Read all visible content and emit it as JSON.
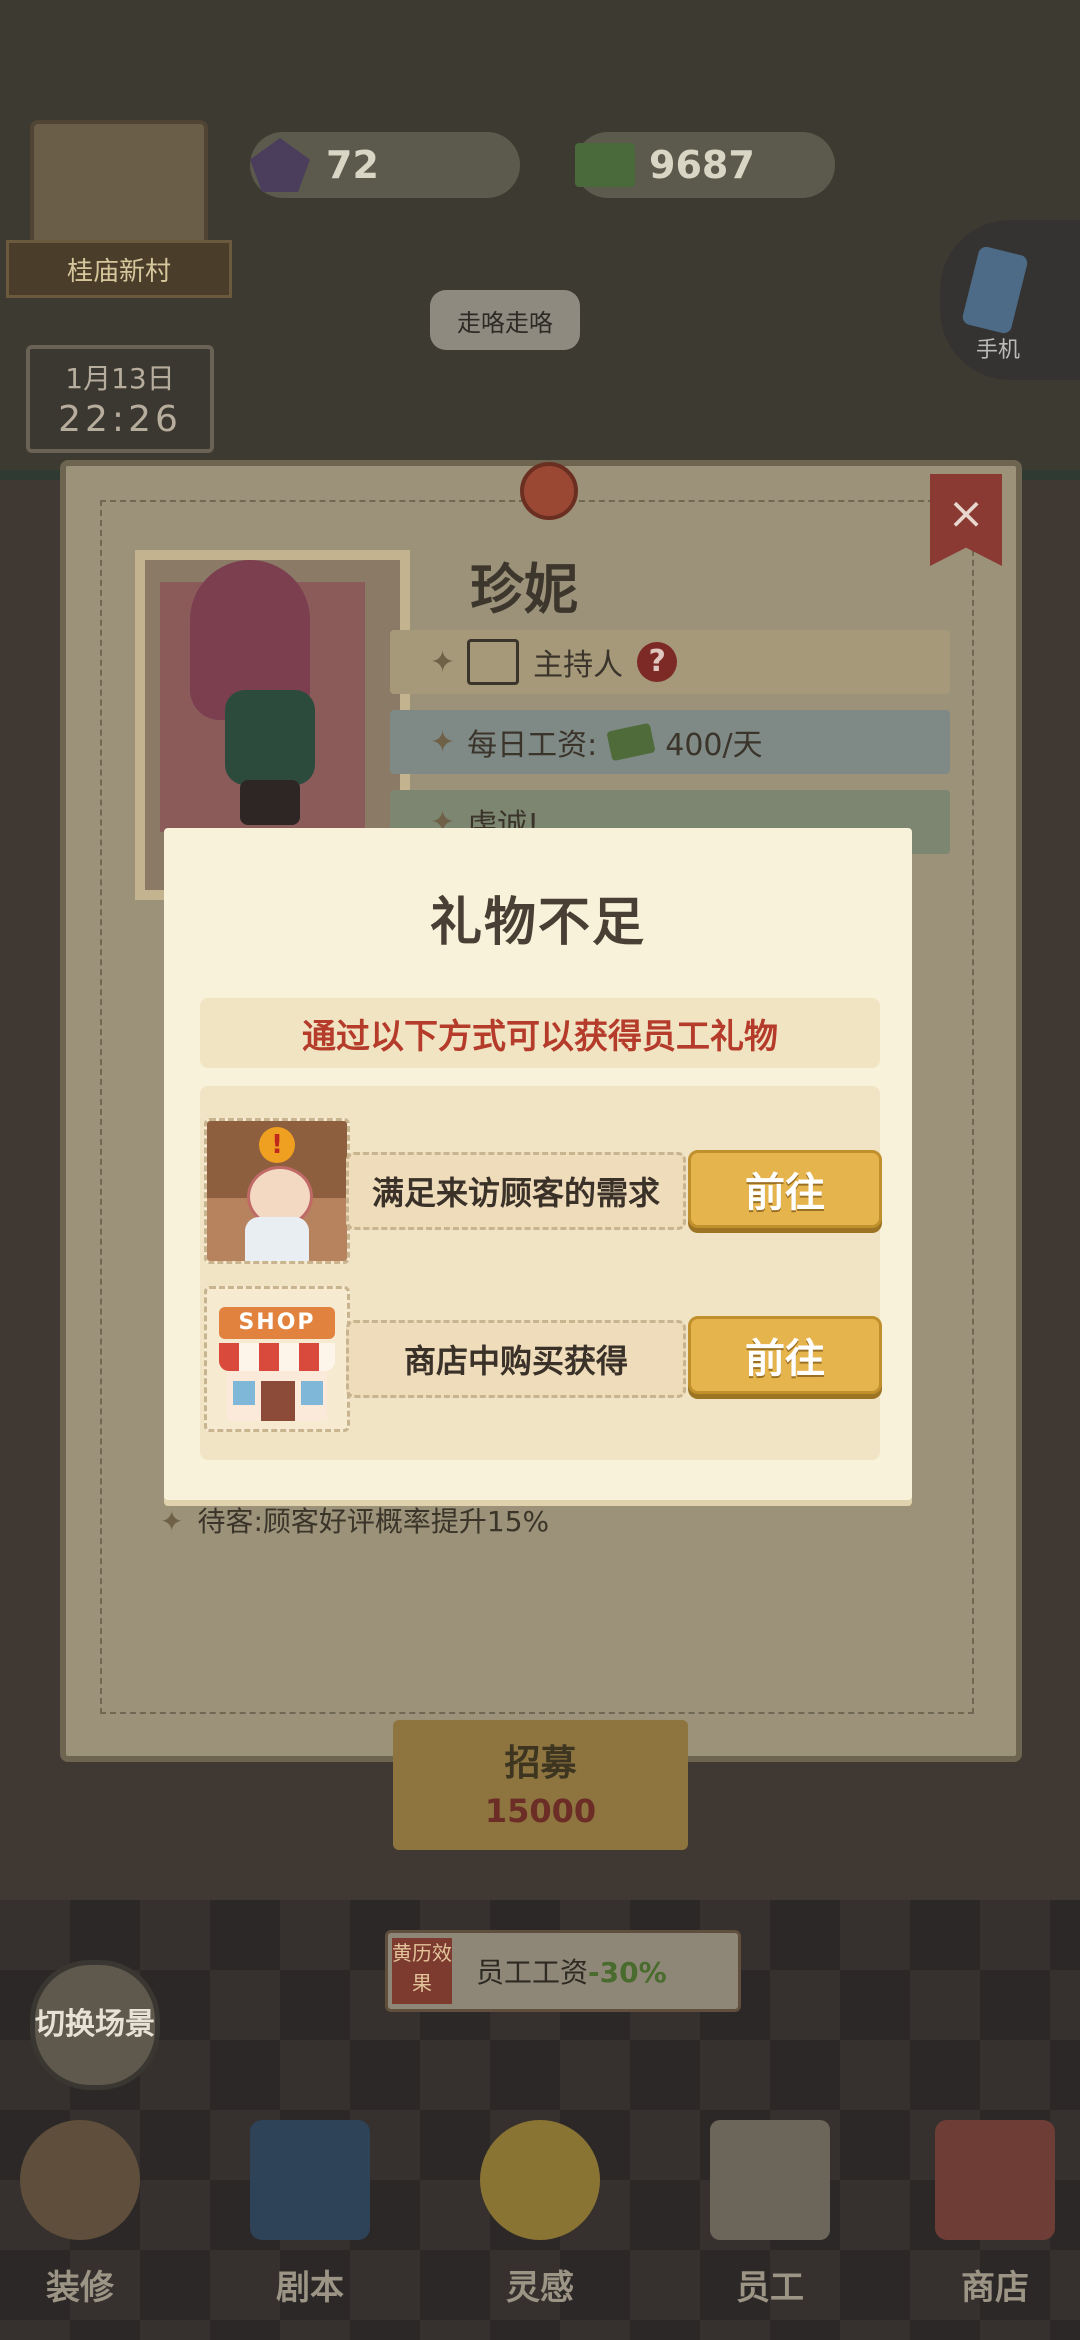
{
  "hud": {
    "gems": "72",
    "cash": "9687",
    "village": "桂庙新村",
    "date": "1月13日",
    "time": "22:26",
    "phone_label": "手机",
    "bubble": "走咯走咯"
  },
  "character_card": {
    "name": "珍妮",
    "role": "主持人",
    "role_help": "?",
    "wage_label": "每日工资:",
    "wage_value": "400/天",
    "row3_text": "虔诚!",
    "trait": "待客:顾客好评概率提升15%",
    "close": "×",
    "hire_label": "招募",
    "hire_price": "15000"
  },
  "popup": {
    "title": "礼物不足",
    "subtitle": "通过以下方式可以获得员工礼物",
    "options": [
      {
        "label": "满足来访顾客的需求",
        "button": "前往",
        "icon": "customer-girl-icon"
      },
      {
        "label": "商店中购买获得",
        "button": "前往",
        "icon": "shop-icon",
        "sign": "SHOP"
      }
    ]
  },
  "calendar_effect": {
    "tag": "黄历效果",
    "text": "员工工资",
    "value": "-30%"
  },
  "switch_scene": "切换场景",
  "nav": [
    {
      "label": "装修",
      "icon": "decorate-icon"
    },
    {
      "label": "剧本",
      "icon": "script-book-icon"
    },
    {
      "label": "灵感",
      "icon": "inspiration-icon"
    },
    {
      "label": "员工",
      "icon": "staff-card-icon"
    },
    {
      "label": "商店",
      "icon": "shop-icon"
    }
  ]
}
